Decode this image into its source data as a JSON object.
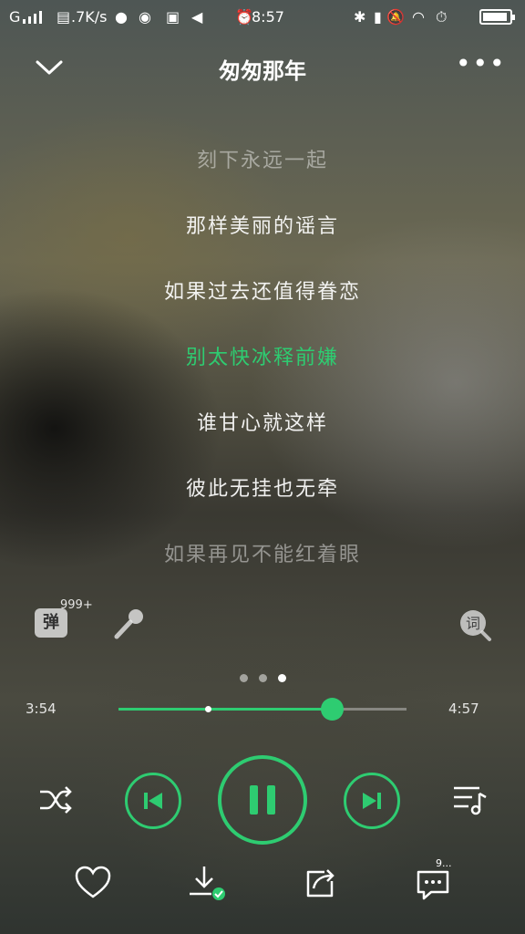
{
  "status_bar": {
    "signal": "G",
    "speed": ".7K/s",
    "time": "8:57",
    "battery_level": 0.95
  },
  "header": {
    "title": "匆匆那年"
  },
  "lyrics": [
    "刻下永远一起",
    "那样美丽的谣言",
    "如果过去还值得眷恋",
    "别太快冰释前嫌",
    "谁甘心就这样",
    "彼此无挂也无牵",
    "如果再见不能红着眼"
  ],
  "current_lyric_index": 3,
  "tools": {
    "danmu_label": "弹",
    "danmu_count": "999+",
    "lyric_label": "词"
  },
  "pager": {
    "count": 3,
    "active": 2
  },
  "progress": {
    "elapsed": "3:54",
    "total": "4:57",
    "played_fraction": 0.74,
    "buffer_fraction": 0.31
  },
  "comment_count": "9..."
}
